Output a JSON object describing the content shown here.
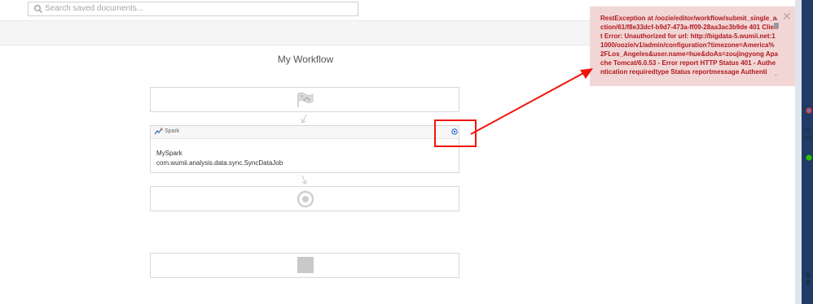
{
  "search": {
    "placeholder": "Search saved documents..."
  },
  "workflow": {
    "title": "My Workflow",
    "spark_node": {
      "type_label": "Spark",
      "name": "MySpark",
      "class_name": "com.wumii.analysis.data.sync.SyncDataJob"
    }
  },
  "error_toast": {
    "message": "RestException at /oozie/editor/workflow/submit_single_action/61/f8e33dcf-b9d7-473a-ff09-28aa3ac3b9de 401 Client Error: Unauthorized for url: http://bigdata-5.wumii.net:11000/oozie/v1/admin/configuration?timezone=America%2FLos_Angeles&user.name=hue&doAs=zoujingyong Apache Tomcat/6.0.53 - Error report HTTP Status 401 - Authentication requiredtype Status reportmessage Authenti"
  },
  "desktop_strip": {
    "items": [
      "G",
      "Ch",
      "有道"
    ]
  },
  "colors": {
    "error_text": "#b0191c",
    "error_bg": "#f2d6d6",
    "annotation": "#f2140c"
  }
}
